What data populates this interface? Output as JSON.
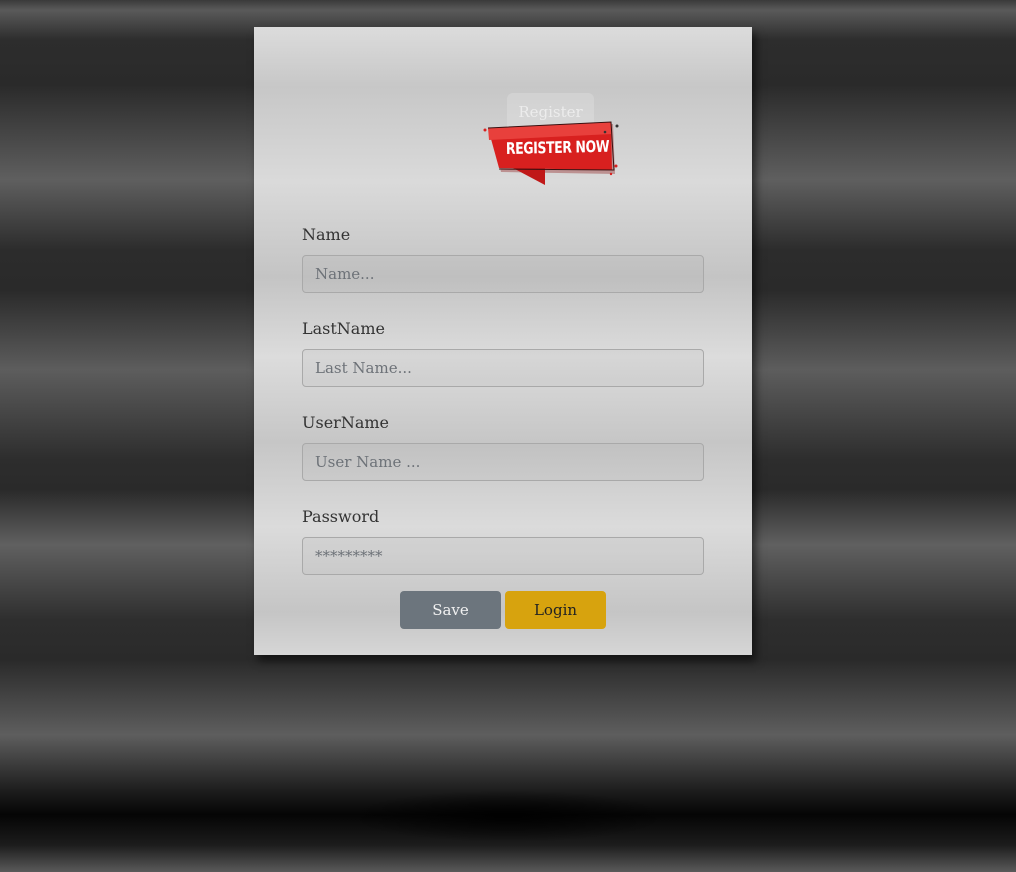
{
  "header": {
    "ghost_button_label": "Register",
    "badge_text": "REGISTER NOW"
  },
  "form": {
    "fields": [
      {
        "label": "Name",
        "placeholder": "Name...",
        "value": ""
      },
      {
        "label": "LastName",
        "placeholder": "Last Name...",
        "value": ""
      },
      {
        "label": "UserName",
        "placeholder": "User Name ...",
        "value": ""
      },
      {
        "label": "Password",
        "placeholder": "*********",
        "value": ""
      }
    ],
    "save_label": "Save",
    "login_label": "Login"
  },
  "colors": {
    "save_button": "#6c757d",
    "login_button": "#d7a30e",
    "badge_red": "#d8201f"
  }
}
